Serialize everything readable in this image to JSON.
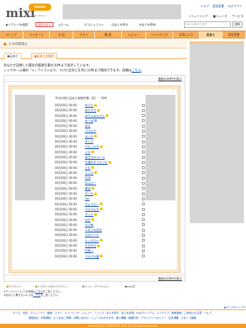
{
  "header": {
    "logo": "mixi",
    "logo_tag": "Station",
    "logo_sub": "Beta Version",
    "help_links": [
      "ヘルプ",
      "設定変更",
      "ログアウト"
    ],
    "right_icons": [
      "ミュージック",
      "ニュース",
      "サービス"
    ]
  },
  "subnav": {
    "items": [
      "ミクシィを検索",
      "ホーム",
      "コミュニティ",
      "友人を探す",
      "友人を招待"
    ],
    "invite_label": "招待 ボタン",
    "search_placeholder": "mixi 全体から探す",
    "search_button": "検索"
  },
  "mainnav": {
    "tabs": [
      "トップ",
      "メッセージ",
      "日 記",
      "フォト",
      "動 画",
      "レビュー",
      "ミュージック",
      "お気に入り",
      "足あと",
      "設定変更"
    ],
    "active_index": 8
  },
  "page": {
    "title": "ミクの足あと",
    "tabs": [
      "足あと",
      "足あとの設定"
    ]
  },
  "intro": {
    "line1": "あなたが訪問した最近の履歴を最大30件まで表示しています。",
    "line2": "ニックネーム横の「×」アイコンより、つけた足あとを月に10件まで削除できます。詳細は",
    "link": "こちら",
    "line2_end": "。"
  },
  "box": {
    "top_link": "最新の30件を表示",
    "bottom_link": "最新の30件を表示",
    "list_header": "今月の残り足あと削除件数（回）：10件"
  },
  "visits": [
    {
      "date": "00月00日 00:00",
      "name": "ゆうた",
      "emoji": "y"
    },
    {
      "date": "00月00日 00:00",
      "name": "ありすさ",
      "emoji": "y"
    },
    {
      "date": "00月00日 00:00",
      "name": "みさんみんさん",
      "emoji": "y"
    },
    {
      "date": "00月00日 00:00",
      "name": "ゆーぽ",
      "emoji": "b"
    },
    {
      "date": "00月00日 00:00",
      "name": "ゆき",
      "emoji": ""
    },
    {
      "date": "00月00日 00:00",
      "name": "ブラピヤ",
      "emoji": ""
    },
    {
      "date": "00月00日 00:00",
      "name": "まいか",
      "emoji": "y"
    },
    {
      "date": "00月00日 00:00",
      "name": "ダッフ",
      "emoji": ""
    },
    {
      "date": "00月00日 00:00",
      "name": "でんこもり",
      "emoji": "y"
    },
    {
      "date": "00月00日 00:00",
      "name": "ミキ",
      "emoji": "y"
    },
    {
      "date": "00月00日 00:00",
      "name": "あさひのコーラ",
      "emoji": ""
    },
    {
      "date": "00月00日 00:00",
      "name": "大通れそうだった",
      "emoji": "y"
    },
    {
      "date": "00月00日 00:00",
      "name": "とも",
      "emoji": "y"
    },
    {
      "date": "00月00日 00:00",
      "name": "ミンカ",
      "emoji": "y"
    },
    {
      "date": "00月00日 00:00",
      "name": "FOR",
      "emoji": ""
    },
    {
      "date": "00月00日 00:00",
      "name": "わんだー",
      "emoji": ""
    },
    {
      "date": "00月00日 00:00",
      "name": "夢見",
      "emoji": "y"
    },
    {
      "date": "00月00日 00:00",
      "name": "ボッカ",
      "emoji": "y"
    },
    {
      "date": "00月00日 00:00",
      "name": "ron",
      "emoji": ""
    },
    {
      "date": "00月00日 00:00",
      "name": "ちょりもー",
      "emoji": "y"
    },
    {
      "date": "00月00日 00:00",
      "name": "ぺんぺんた",
      "emoji": "y"
    },
    {
      "date": "00月00日 00:00",
      "name": "マッド",
      "emoji": "y"
    },
    {
      "date": "00月00日 00:00",
      "name": "ぴぴ",
      "emoji": "y"
    },
    {
      "date": "00月00日 00:00",
      "name": "カジ柿",
      "emoji": ""
    },
    {
      "date": "00月00日 00:00",
      "name": "ぐれぐれ先生",
      "emoji": ""
    },
    {
      "date": "00月00日 00:00",
      "name": "カタリーナ",
      "emoji": ""
    },
    {
      "date": "00月00日 00:00",
      "name": "ルックロー",
      "emoji": "y"
    },
    {
      "date": "00月00日 00:00",
      "name": "そびそび",
      "emoji": "y"
    },
    {
      "date": "00月00日 00:00",
      "name": "目表一",
      "emoji": ""
    },
    {
      "date": "00月00日 00:00",
      "name": "ペルペル屋",
      "emoji": "y"
    }
  ],
  "legend": [
    "マイミクシィ",
    "マイミクシィのマイミクシィ",
    "アレット・アーティスト",
    "mixi公式"
  ],
  "notes": {
    "line1": "※アイコンについての詳細は",
    "line1_link": "こちら",
    "line1_end": "をご覧ください。",
    "line2": "※足あとに関するヘルプは",
    "line2_link": "こちら",
    "line2_end": "をご覧ください。"
  },
  "pagetop": "▲ページのトップへ",
  "footer": {
    "line1": [
      "ホーム",
      "日記",
      "コミュニティ",
      "動画",
      "フォト",
      "ミュージック",
      "レビュー",
      "ニュース",
      "友人を探す",
      "友人を招待",
      "mixiプレミアム",
      "インテリア",
      "検索検索",
      "ご利用上の注意",
      "ヘルプ"
    ],
    "line2": [
      "運営会社",
      "利用規約",
      "よくあるご質問",
      "お問い合わせ",
      "ニュースのそれぞれ",
      "個人情報",
      "保護方針",
      "プライバシーポリシー",
      "広告掲載",
      "スタッフ募集"
    ],
    "copyright": "Copyright (C) 1999-2009 mixi, Inc. All rights reserved."
  },
  "colors": {
    "accent": "#f39c2a",
    "nav_bg": "#f7ad5a",
    "link": "#0044aa"
  }
}
